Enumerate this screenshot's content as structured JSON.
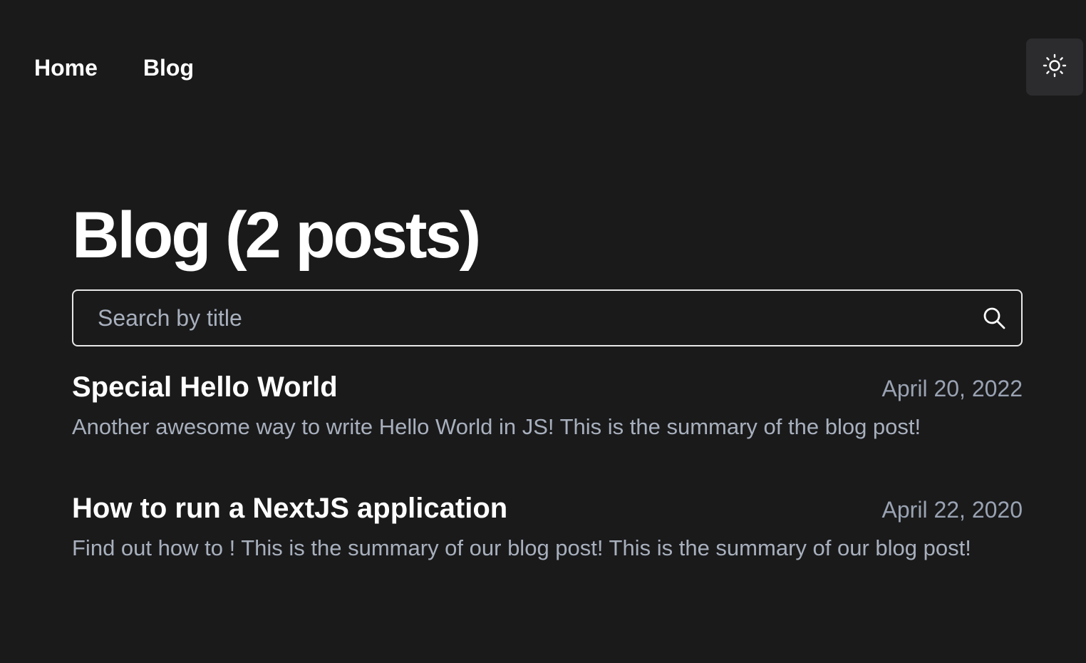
{
  "nav": {
    "home_label": "Home",
    "blog_label": "Blog"
  },
  "theme_toggle": {
    "icon": "sun-icon"
  },
  "page": {
    "title": "Blog (2 posts)"
  },
  "search": {
    "value": "",
    "placeholder": "Search by title",
    "icon": "search-icon"
  },
  "posts": [
    {
      "title": "Special Hello World",
      "date": "April 20, 2022",
      "summary": "Another awesome way to write Hello World in JS! This is the summary of the blog post!"
    },
    {
      "title": "How to run a NextJS application",
      "date": "April 22, 2020",
      "summary": "Find out how to ! This is the summary of our blog post! This is the summary of our blog post!"
    }
  ],
  "colors": {
    "background": "#1a1a1b",
    "text": "#ffffff",
    "muted": "#a8b0bd",
    "toggle_bg": "#2c2c2e"
  }
}
